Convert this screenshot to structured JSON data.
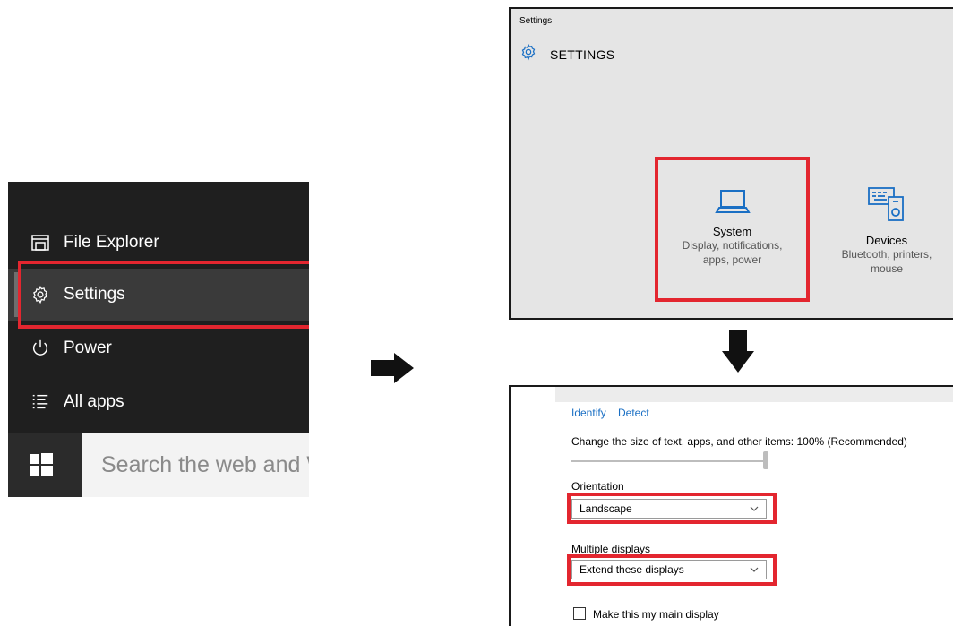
{
  "start_menu": {
    "items": [
      {
        "label": "File Explorer",
        "icon": "file-explorer-icon"
      },
      {
        "label": "Settings",
        "icon": "gear-icon",
        "selected": true
      },
      {
        "label": "Power",
        "icon": "power-icon"
      },
      {
        "label": "All apps",
        "icon": "all-apps-icon"
      }
    ],
    "search_placeholder": "Search the web and W",
    "start_button_icon": "windows-logo-icon"
  },
  "settings_window": {
    "title": "Settings",
    "header": "SETTINGS",
    "tiles": [
      {
        "title": "System",
        "desc_line1": "Display, notifications,",
        "desc_line2": "apps, power",
        "icon": "laptop-icon"
      },
      {
        "title": "Devices",
        "desc_line1": "Bluetooth, printers,",
        "desc_line2": "mouse",
        "icon": "devices-icon"
      }
    ]
  },
  "display_settings": {
    "links": [
      "Identify",
      "Detect"
    ],
    "scale_text": "Change the size of text, apps, and other items: 100% (Recommended)",
    "orientation_label": "Orientation",
    "orientation_value": "Landscape",
    "multiple_displays_label": "Multiple displays",
    "multiple_displays_value": "Extend these displays",
    "main_display_checkbox": "Make this my main display",
    "main_display_checked": false
  },
  "colors": {
    "highlight": "#e3262f",
    "accent": "#1a6fc4",
    "start_bg": "#1f1f1f"
  }
}
